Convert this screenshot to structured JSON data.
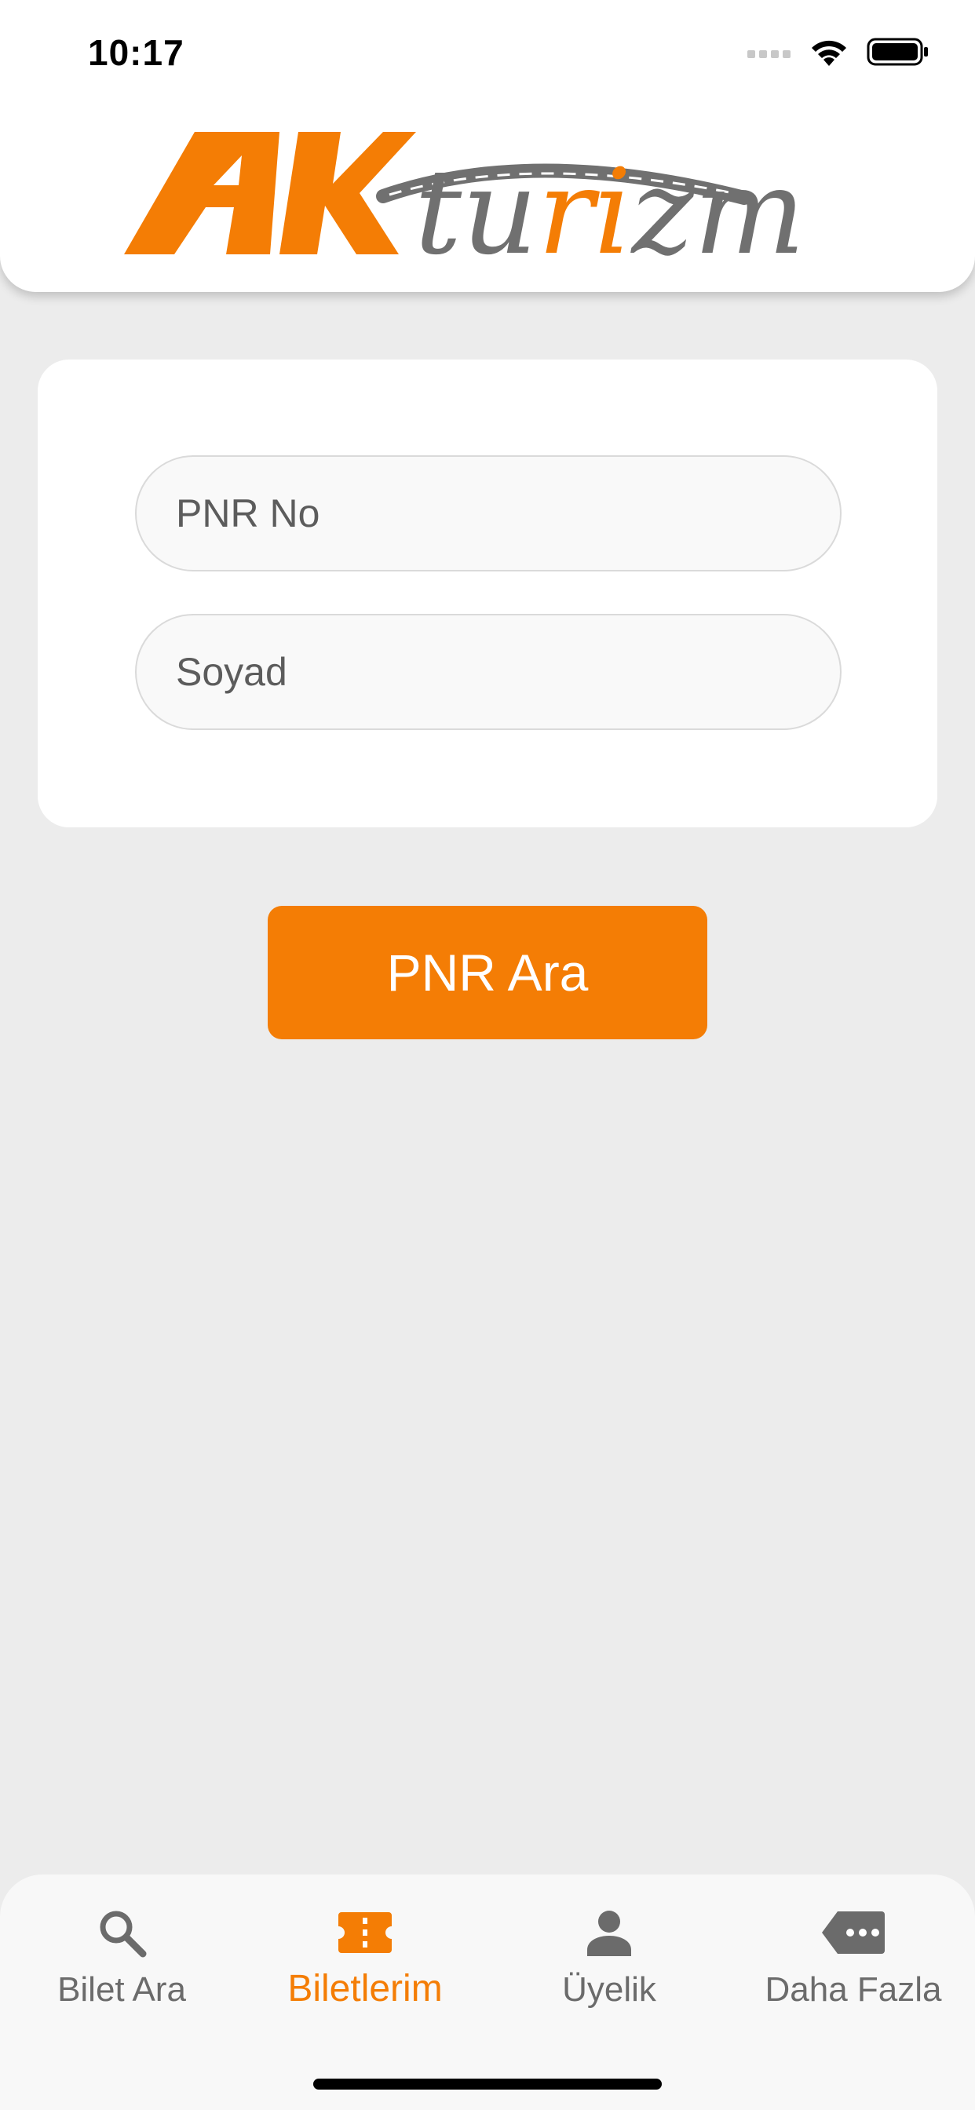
{
  "status_bar": {
    "time": "10:17"
  },
  "header": {
    "logo_text_ak": "AK",
    "logo_text_turizm": "turizm"
  },
  "form": {
    "pnr_placeholder": "PNR No",
    "pnr_value": "",
    "soyad_placeholder": "Soyad",
    "soyad_value": ""
  },
  "actions": {
    "search_label": "PNR Ara"
  },
  "tabbar": {
    "active": "Biletlerim",
    "items": [
      {
        "label": "Bilet Ara",
        "icon": "search-icon"
      },
      {
        "label": "Biletlerim",
        "icon": "ticket-icon"
      },
      {
        "label": "Üyelik",
        "icon": "person-icon"
      },
      {
        "label": "Daha Fazla",
        "icon": "more-tag-icon"
      }
    ]
  },
  "colors": {
    "accent": "#f47d05",
    "logo_gray": "#707070",
    "background": "#ececec",
    "inactive_tab": "#6b6b6b"
  }
}
